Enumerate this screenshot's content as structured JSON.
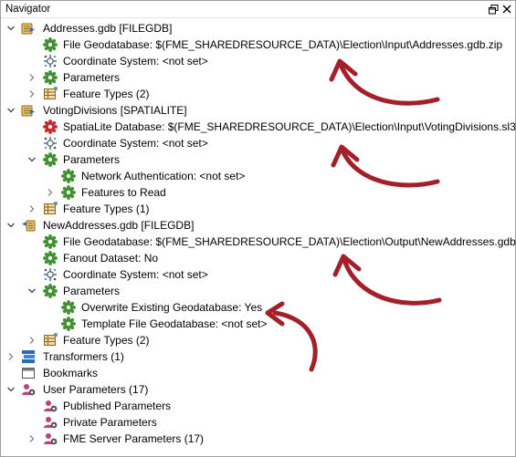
{
  "panel": {
    "title": "Navigator",
    "restore_icon": "restore-window-icon",
    "close_icon": "close-icon"
  },
  "tree": {
    "readers": [
      {
        "name": "Addresses.gdb [FILEGDB]",
        "icon": "reader-icon",
        "children": {
          "dataset": "File Geodatabase: $(FME_SHAREDRESOURCE_DATA)\\Election\\Input\\Addresses.gdb.zip",
          "coord": "Coordinate System: <not set>",
          "params": "Parameters",
          "ftypes": "Feature Types (2)"
        }
      },
      {
        "name": "VotingDivisions [SPATIALITE]",
        "icon": "reader-icon",
        "children": {
          "dataset": "SpatiaLite Database: $(FME_SHAREDRESOURCE_DATA)\\Election\\Input\\VotingDivisions.sl3",
          "coord": "Coordinate System: <not set>",
          "params": "Parameters",
          "param_items": [
            "Network Authentication: <not set>",
            "Features to Read"
          ],
          "ftypes": "Feature Types (1)"
        }
      }
    ],
    "writer": {
      "name": "NewAddresses.gdb [FILEGDB]",
      "icon": "writer-icon",
      "children": {
        "dataset": "File Geodatabase: $(FME_SHAREDRESOURCE_DATA)\\Election\\Output\\NewAddresses.gdb.zip",
        "fanout": "Fanout Dataset: No",
        "coord": "Coordinate System: <not set>",
        "params": "Parameters",
        "param_items": [
          "Overwrite Existing Geodatabase: Yes",
          "Template File Geodatabase: <not set>"
        ],
        "ftypes": "Feature Types (2)"
      }
    },
    "transformers": "Transformers (1)",
    "bookmarks": "Bookmarks",
    "user_params": {
      "label": "User Parameters (17)",
      "items": [
        "Published Parameters",
        "Private Parameters",
        "FME Server Parameters (17)"
      ]
    }
  },
  "colors": {
    "gear_green": "#3f8f2f",
    "gear_red": "#c8262b",
    "annotation_arrow": "#a3202a",
    "param_pink": "#c2407a"
  }
}
